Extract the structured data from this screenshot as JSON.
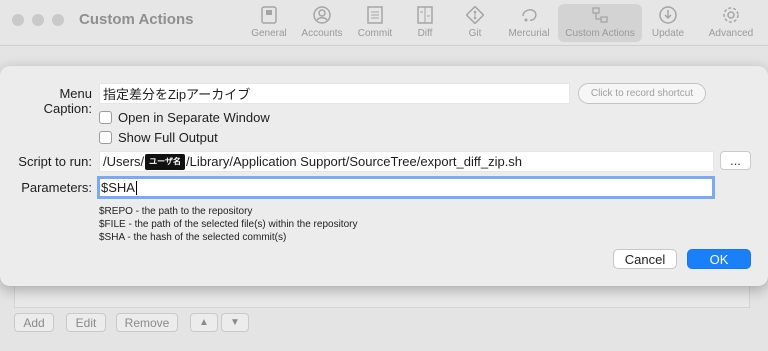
{
  "window": {
    "title": "Custom Actions",
    "toolbar": [
      {
        "label": "General",
        "icon": "switch-icon"
      },
      {
        "label": "Accounts",
        "icon": "person-icon"
      },
      {
        "label": "Commit",
        "icon": "document-icon"
      },
      {
        "label": "Diff",
        "icon": "diff-icon"
      },
      {
        "label": "Git",
        "icon": "git-icon"
      },
      {
        "label": "Mercurial",
        "icon": "mercurial-icon"
      },
      {
        "label": "Custom Actions",
        "icon": "custom-actions-icon",
        "active": true
      },
      {
        "label": "Update",
        "icon": "download-icon"
      },
      {
        "label": "Advanced",
        "icon": "gear-icon"
      }
    ]
  },
  "list_buttons": {
    "add": "Add",
    "edit": "Edit",
    "remove": "Remove",
    "up": "▲",
    "down": "▼"
  },
  "sheet": {
    "menu_caption_label": "Menu Caption:",
    "menu_caption_value": "指定差分をZipアーカイブ",
    "shortcut_placeholder": "Click to record shortcut",
    "open_separate_window": "Open in Separate Window",
    "show_full_output": "Show Full Output",
    "script_label": "Script to run:",
    "script_prefix": "/Users/",
    "script_redacted": "ユーザ名",
    "script_suffix": "/Library/Application Support/SourceTree/export_diff_zip.sh",
    "ellipsis": "...",
    "parameters_label": "Parameters:",
    "parameters_value": "$SHA",
    "help_lines": [
      "$REPO - the path to the repository",
      "$FILE - the path of the selected file(s) within the repository",
      "$SHA - the hash of the selected commit(s)"
    ],
    "cancel": "Cancel",
    "ok": "OK"
  },
  "colors": {
    "accent": "#1a80f9",
    "focus_ring": "#7aaaf3"
  }
}
